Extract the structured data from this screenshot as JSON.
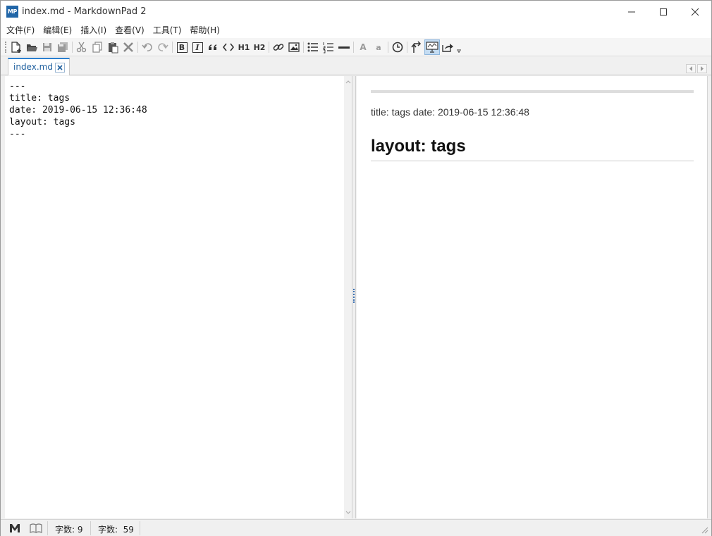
{
  "window": {
    "logo_text": "MP",
    "title": "index.md - MarkdownPad 2"
  },
  "menu": [
    "文件(F)",
    "编辑(E)",
    "插入(I)",
    "查看(V)",
    "工具(T)",
    "帮助(H)"
  ],
  "toolbar": {
    "h1_label": "H1",
    "h2_label": "H2",
    "bold_label": "B",
    "italic_label": "I",
    "font_large_label": "A",
    "font_small_label": "a"
  },
  "tab": {
    "label": "index.md"
  },
  "editor": {
    "text": "---\ntitle: tags\ndate: 2019-06-15 12:36:48\nlayout: tags\n---"
  },
  "preview": {
    "paragraph": "title: tags date: 2019-06-15 12:36:48",
    "heading": "layout: tags"
  },
  "statusbar": {
    "word_count": "字数: 9",
    "char_count": "字数:  59"
  },
  "colors": {
    "accent": "#2a7fcf",
    "logo": "#2166a8"
  }
}
